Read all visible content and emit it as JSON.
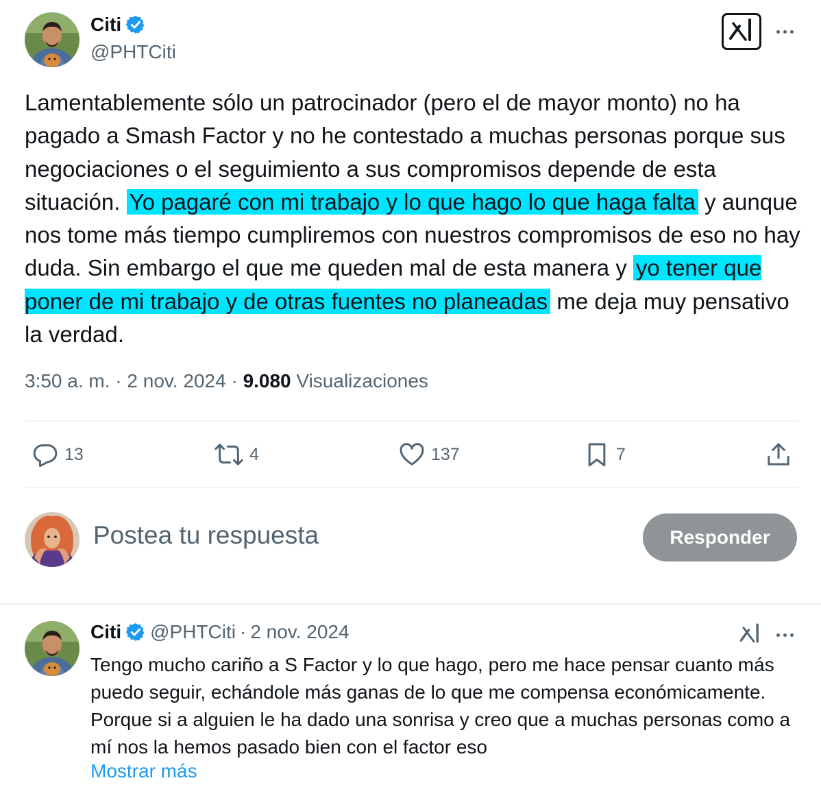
{
  "tweet": {
    "author": {
      "name": "Citi",
      "handle": "@PHTCiti",
      "verified": true
    },
    "text": {
      "part1": "Lamentablemente sólo un patrocinador (pero el de mayor monto) no ha pagado a Smash Factor y no he contestado a muchas personas porque sus negociaciones o el seguimiento a sus compromisos depende de esta situación. ",
      "highlight1": "Yo pagaré con mi trabajo y lo que hago lo que haga falta",
      "part2": " y aunque nos tome más tiempo cumpliremos con nuestros compromisos de eso no hay duda. Sin embargo el que me queden mal de esta manera y ",
      "highlight2": "yo tener que poner de mi trabajo y de otras fuentes no planeadas",
      "part3": " me deja muy pensativo la verdad."
    },
    "meta": {
      "time": "3:50 a. m.",
      "sep1": " · ",
      "date": "2 nov. 2024",
      "sep2": " · ",
      "views_count": "9.080",
      "views_label": " Visualizaciones"
    },
    "actions": {
      "replies": "13",
      "retweets": "4",
      "likes": "137",
      "bookmarks": "7"
    }
  },
  "reply_box": {
    "placeholder": "Postea tu respuesta",
    "button_label": "Responder"
  },
  "reply_tweet": {
    "author": {
      "name": "Citi",
      "handle": "@PHTCiti",
      "verified": true
    },
    "separator": " · ",
    "date": "2 nov. 2024",
    "text": "Tengo mucho cariño a S Factor y lo que hago, pero me hace pensar cuanto más puedo seguir, echándole más ganas de lo que me compensa económicamente. Porque si a alguien le ha dado una sonrisa y creo que a muchas personas como a mí nos la hemos pasado bien con el factor eso",
    "show_more": "Mostrar más"
  },
  "colors": {
    "highlight": "#00e5ff",
    "verified": "#1d9bf0",
    "link": "#1d9bf0",
    "secondary_text": "#536471",
    "button_disabled": "#8f9497"
  },
  "icons": [
    "verified-badge-icon",
    "grok-icon",
    "more-icon",
    "reply-icon",
    "retweet-icon",
    "like-icon",
    "bookmark-icon",
    "share-icon"
  ]
}
